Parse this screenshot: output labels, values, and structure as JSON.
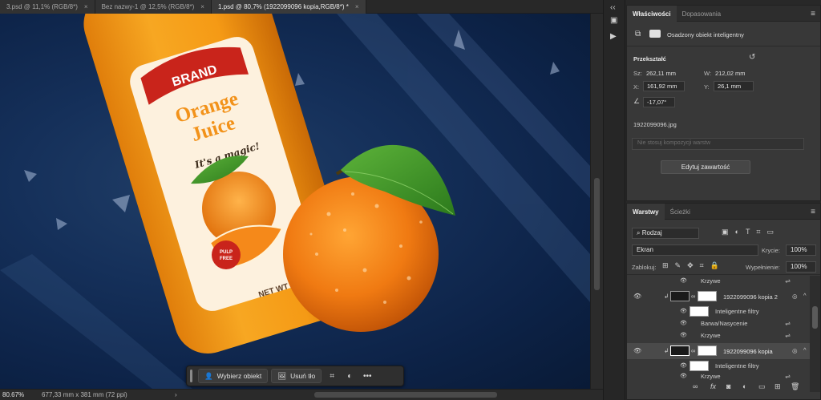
{
  "tabs": [
    {
      "label": "3.psd @ 11,1% (RGB/8*)",
      "close": "×"
    },
    {
      "label": "Bez nazwy-1 @ 12,5% (RGB/8*)",
      "close": "×"
    },
    {
      "label": "1.psd @ 80,7% (1922099096 kopia,RGB/8*) *",
      "close": "×"
    }
  ],
  "artwork": {
    "brand": "BRAND",
    "product_line1": "Orange",
    "product_line2": "Juice",
    "slogan": "It's a magic!",
    "badge_line1": "PULP",
    "badge_line2": "FREE",
    "net": "NET WT 1"
  },
  "context_bar": {
    "select_subject": "Wybierz obiekt",
    "remove_bg": "Usuń tło",
    "more": "•••"
  },
  "status": {
    "zoom": "80.67%",
    "dimensions": "677,33 mm x 381 mm (72 ppi)",
    "arrow": "›"
  },
  "properties": {
    "tab_active": "Właściwości",
    "tab_inactive": "Dopasowania",
    "object_type": "Osadzony obiekt inteligentny",
    "transform_title": "Przekształć",
    "w_label": "Sz:",
    "w_value": "262,11 mm",
    "h_label": "W:",
    "h_value": "212,02 mm",
    "x_label": "X:",
    "x_value": "161,92 mm",
    "y_label": "Y:",
    "y_value": "26,1 mm",
    "angle_value": "-17,07°",
    "filename": "1922099096.jpg",
    "comp_placeholder": "Nie stosuj kompozycji warstw",
    "edit_button": "Edytuj zawartość"
  },
  "layers": {
    "tab_active": "Warstwy",
    "tab_inactive": "Ścieżki",
    "filter_kind": "Rodzaj",
    "blend_mode": "Ekran",
    "opacity_label": "Krycie:",
    "opacity_value": "100%",
    "lock_label": "Zablokuj:",
    "fill_label": "Wypełnienie:",
    "fill_value": "100%",
    "rows": [
      {
        "name": "Krzywe"
      },
      {
        "name": "1922099096 kopia 2"
      },
      {
        "name": "Inteligentne filtry"
      },
      {
        "name": "Barwa/Nasycenie"
      },
      {
        "name": "Krzywe"
      },
      {
        "name": "1922099096 kopia"
      },
      {
        "name": "Inteligentne filtry"
      },
      {
        "name": "Krzywe"
      }
    ]
  },
  "colors": {
    "canvas_bg": "#0d2348",
    "accent_orange": "#f39a1c",
    "brand_red": "#c9241b",
    "panel_bg": "#383838"
  }
}
